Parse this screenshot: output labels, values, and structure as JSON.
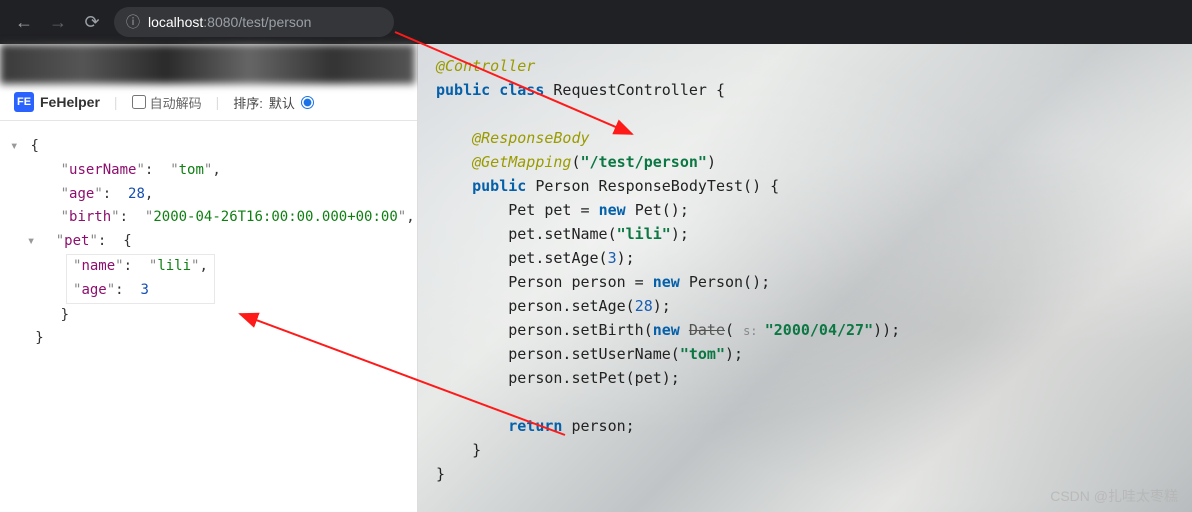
{
  "browser": {
    "url_host": "localhost",
    "url_port": ":8080",
    "url_path": "/test/person"
  },
  "fehelper": {
    "brand": "FeHelper",
    "auto_decode_label": "自动解码",
    "sort_label": "排序:",
    "sort_default_label": "默认"
  },
  "json": {
    "userName_key": "userName",
    "userName_val": "tom",
    "age_key": "age",
    "age_val": "28",
    "birth_key": "birth",
    "birth_val": "2000-04-26T16:00:00.000+00:00",
    "pet_key": "pet",
    "pet_name_key": "name",
    "pet_name_val": "lili",
    "pet_age_key": "age",
    "pet_age_val": "3"
  },
  "code": {
    "anno_controller": "@Controller",
    "class_decl_1": "public class ",
    "class_name": "RequestController {",
    "anno_responsebody": "@ResponseBody",
    "anno_getmapping": "@GetMapping",
    "getmapping_path": "\"/test/person\"",
    "method_sig_1": "public ",
    "method_sig_2": "Person ResponseBodyTest() {",
    "l1_a": "Pet pet = ",
    "l1_b": "new ",
    "l1_c": "Pet();",
    "l2_a": "pet.setName(",
    "l2_b": "\"lili\"",
    "l2_c": ");",
    "l3_a": "pet.setAge(",
    "l3_b": "3",
    "l3_c": ");",
    "l4_a": "Person person = ",
    "l4_b": "new ",
    "l4_c": "Person();",
    "l5_a": "person.setAge(",
    "l5_b": "28",
    "l5_c": ");",
    "l6_a": "person.setBirth(",
    "l6_b": "new ",
    "l6_c": "Date",
    "l6_d": "( ",
    "l6_param": "s: ",
    "l6_e": "\"2000/04/27\"",
    "l6_f": "));",
    "l7_a": "person.setUserName(",
    "l7_b": "\"tom\"",
    "l7_c": ");",
    "l8": "person.setPet(pet);",
    "l_return_a": "return ",
    "l_return_b": "person;",
    "brace_close": "}"
  },
  "watermark": "CSDN @扎哇太枣糕"
}
